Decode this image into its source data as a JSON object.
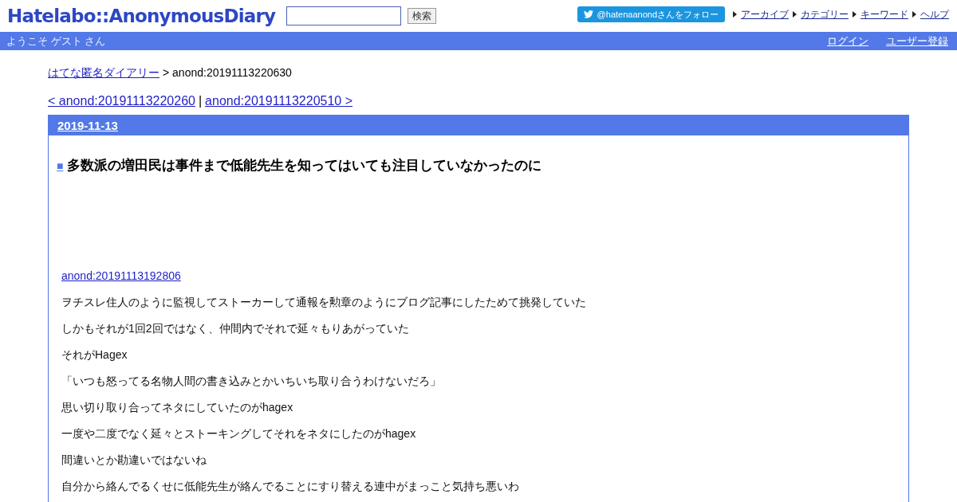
{
  "header": {
    "logo": "Hatelabo::AnonymousDiary",
    "search_button": "検索",
    "follow_button": "@hatenaanondさんをフォロー",
    "links": [
      "アーカイブ",
      "カテゴリー",
      "キーワード",
      "ヘルプ"
    ]
  },
  "user_bar": {
    "welcome": "ようこそ ゲスト さん",
    "links": [
      "ログイン",
      "ユーザー登録"
    ]
  },
  "breadcrumb": {
    "link": "はてな匿名ダイアリー",
    "current": "> anond:20191113220630"
  },
  "pager": {
    "prev": "< anond:20191113220260",
    "separator": "|",
    "next": "anond:20191113220510 >"
  },
  "day": {
    "date": "2019-11-13",
    "title_mark": "■",
    "title": "多数派の増田民は事件まで低能先生を知ってはいても注目していなかったのに",
    "ref_link": "anond:20191113192806",
    "paragraphs": [
      "ヲチスレ住人のように監視してストーカーして通報を勲章のようにブログ記事にしたためて挑発していた",
      "しかもそれが1回2回ではなく、仲間内でそれで延々もりあがっていた",
      "それがHagex",
      "「いつも怒ってる名物人間の書き込みとかいちいち取り合うわけないだろ」",
      "思い切り取り合ってネタにしていたのがhagex",
      "一度や二度でなく延々とストーキングしてそれをネタにしたのがhagex",
      "間違いとか勘違いではないね",
      "自分から絡んでるくせに低能先生が絡んでることにすり替える連中がまっこと気持ち悪いわ"
    ]
  }
}
